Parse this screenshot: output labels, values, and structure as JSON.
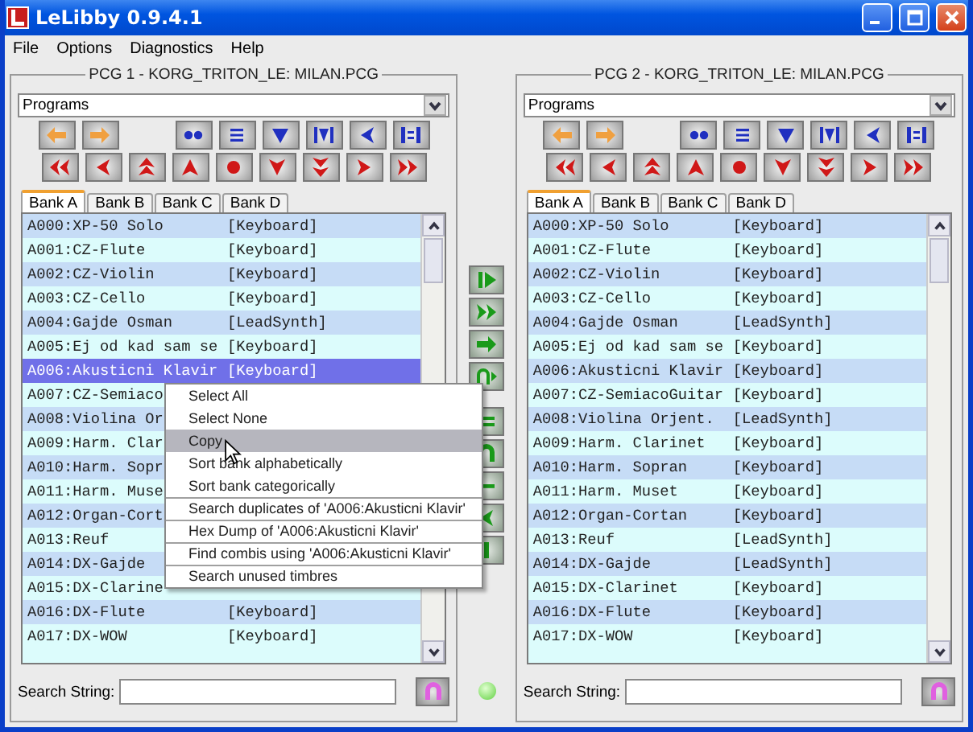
{
  "window": {
    "title": "LeLibby 0.9.4.1"
  },
  "menu": [
    "File",
    "Options",
    "Diagnostics",
    "Help"
  ],
  "panels": [
    {
      "title": "PCG 1 - KORG_TRITON_LE: MILAN.PCG",
      "dropdown": "Programs",
      "tabs": [
        {
          "label": "Bank A",
          "selected": true
        },
        {
          "label": "Bank B",
          "selected": false
        },
        {
          "label": "Bank C",
          "selected": false
        },
        {
          "label": "Bank D",
          "selected": false
        }
      ],
      "rows": [
        {
          "name": "A000:XP-50 Solo",
          "category": "[Keyboard]",
          "selected": false
        },
        {
          "name": "A001:CZ-Flute",
          "category": "[Keyboard]",
          "selected": false
        },
        {
          "name": "A002:CZ-Violin",
          "category": "[Keyboard]",
          "selected": false
        },
        {
          "name": "A003:CZ-Cello",
          "category": "[Keyboard]",
          "selected": false
        },
        {
          "name": "A004:Gajde Osman",
          "category": "[LeadSynth]",
          "selected": false
        },
        {
          "name": "A005:Ej od kad sam se",
          "category": "[Keyboard]",
          "selected": false
        },
        {
          "name": "A006:Akusticni Klavir",
          "category": "[Keyboard]",
          "selected": true
        },
        {
          "name": "A007:CZ-Semiaco",
          "selected": false
        },
        {
          "name": "A008:Violina Or",
          "selected": false
        },
        {
          "name": "A009:Harm. Clar",
          "selected": false
        },
        {
          "name": "A010:Harm. Sopr",
          "selected": false
        },
        {
          "name": "A011:Harm. Muse",
          "selected": false
        },
        {
          "name": "A012:Organ-Cort",
          "selected": false
        },
        {
          "name": "A013:Reuf",
          "selected": false
        },
        {
          "name": "A014:DX-Gajde",
          "selected": false
        },
        {
          "name": "A015:DX-Clarine",
          "selected": false
        },
        {
          "name": "A016:DX-Flute",
          "category": "[Keyboard]",
          "selected": false
        },
        {
          "name": "A017:DX-WOW",
          "category": "[Keyboard]",
          "selected": false
        }
      ],
      "search_label": "Search String:"
    },
    {
      "title": "PCG 2 - KORG_TRITON_LE: MILAN.PCG",
      "dropdown": "Programs",
      "tabs": [
        {
          "label": "Bank A",
          "selected": true
        },
        {
          "label": "Bank B",
          "selected": false
        },
        {
          "label": "Bank C",
          "selected": false
        },
        {
          "label": "Bank D",
          "selected": false
        }
      ],
      "rows": [
        {
          "name": "A000:XP-50 Solo",
          "category": "[Keyboard]",
          "selected": false
        },
        {
          "name": "A001:CZ-Flute",
          "category": "[Keyboard]",
          "selected": false
        },
        {
          "name": "A002:CZ-Violin",
          "category": "[Keyboard]",
          "selected": false
        },
        {
          "name": "A003:CZ-Cello",
          "category": "[Keyboard]",
          "selected": false
        },
        {
          "name": "A004:Gajde Osman",
          "category": "[LeadSynth]",
          "selected": false
        },
        {
          "name": "A005:Ej od kad sam se",
          "category": "[Keyboard]",
          "selected": false
        },
        {
          "name": "A006:Akusticni Klavir",
          "category": "[Keyboard]",
          "selected": false
        },
        {
          "name": "A007:CZ-SemiacoGuitar",
          "category": "[Keyboard]",
          "selected": false
        },
        {
          "name": "A008:Violina Orjent.",
          "category": "[LeadSynth]",
          "selected": false
        },
        {
          "name": "A009:Harm. Clarinet",
          "category": "[Keyboard]",
          "selected": false
        },
        {
          "name": "A010:Harm. Sopran",
          "category": "[Keyboard]",
          "selected": false
        },
        {
          "name": "A011:Harm. Muset",
          "category": "[Keyboard]",
          "selected": false
        },
        {
          "name": "A012:Organ-Cortan",
          "category": "[Keyboard]",
          "selected": false
        },
        {
          "name": "A013:Reuf",
          "category": "[LeadSynth]",
          "selected": false
        },
        {
          "name": "A014:DX-Gajde",
          "category": "[LeadSynth]",
          "selected": false
        },
        {
          "name": "A015:DX-Clarinet",
          "category": "[Keyboard]",
          "selected": false
        },
        {
          "name": "A016:DX-Flute",
          "category": "[Keyboard]",
          "selected": false
        },
        {
          "name": "A017:DX-WOW",
          "category": "[Keyboard]",
          "selected": false
        }
      ],
      "search_label": "Search String:"
    }
  ],
  "context_menu": {
    "items": [
      {
        "label": "Select All",
        "highlighted": false,
        "separator_before": false
      },
      {
        "label": "Select None",
        "highlighted": false,
        "separator_before": false
      },
      {
        "label": "Copy",
        "highlighted": true,
        "separator_before": false
      },
      {
        "label": "Sort bank alphabetically",
        "highlighted": false,
        "separator_before": false
      },
      {
        "label": "Sort bank categorically",
        "highlighted": false,
        "separator_before": false
      },
      {
        "label": "Search duplicates of  'A006:Akusticni Klavir'",
        "highlighted": false,
        "separator_before": true
      },
      {
        "label": "Hex Dump of  'A006:Akusticni Klavir'",
        "highlighted": false,
        "separator_before": true
      },
      {
        "label": "Find combis using 'A006:Akusticni Klavir'",
        "highlighted": false,
        "separator_before": true
      },
      {
        "label": "Search unused timbres",
        "highlighted": false,
        "separator_before": true
      }
    ]
  }
}
